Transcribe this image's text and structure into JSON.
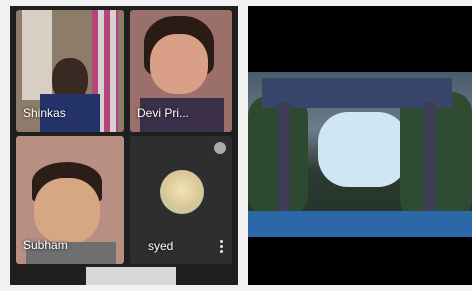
{
  "call": {
    "participants": [
      {
        "name": "Shinkas"
      },
      {
        "name": "Devi Pri..."
      },
      {
        "name": "Subham"
      },
      {
        "name": "syed"
      }
    ]
  },
  "icons": {
    "mic": "mic-icon",
    "more": "more-vert-icon"
  },
  "colors": {
    "call_bg": "#1f1f1f",
    "shared_bg": "#000000",
    "page_bg": "#f2f2f2"
  }
}
